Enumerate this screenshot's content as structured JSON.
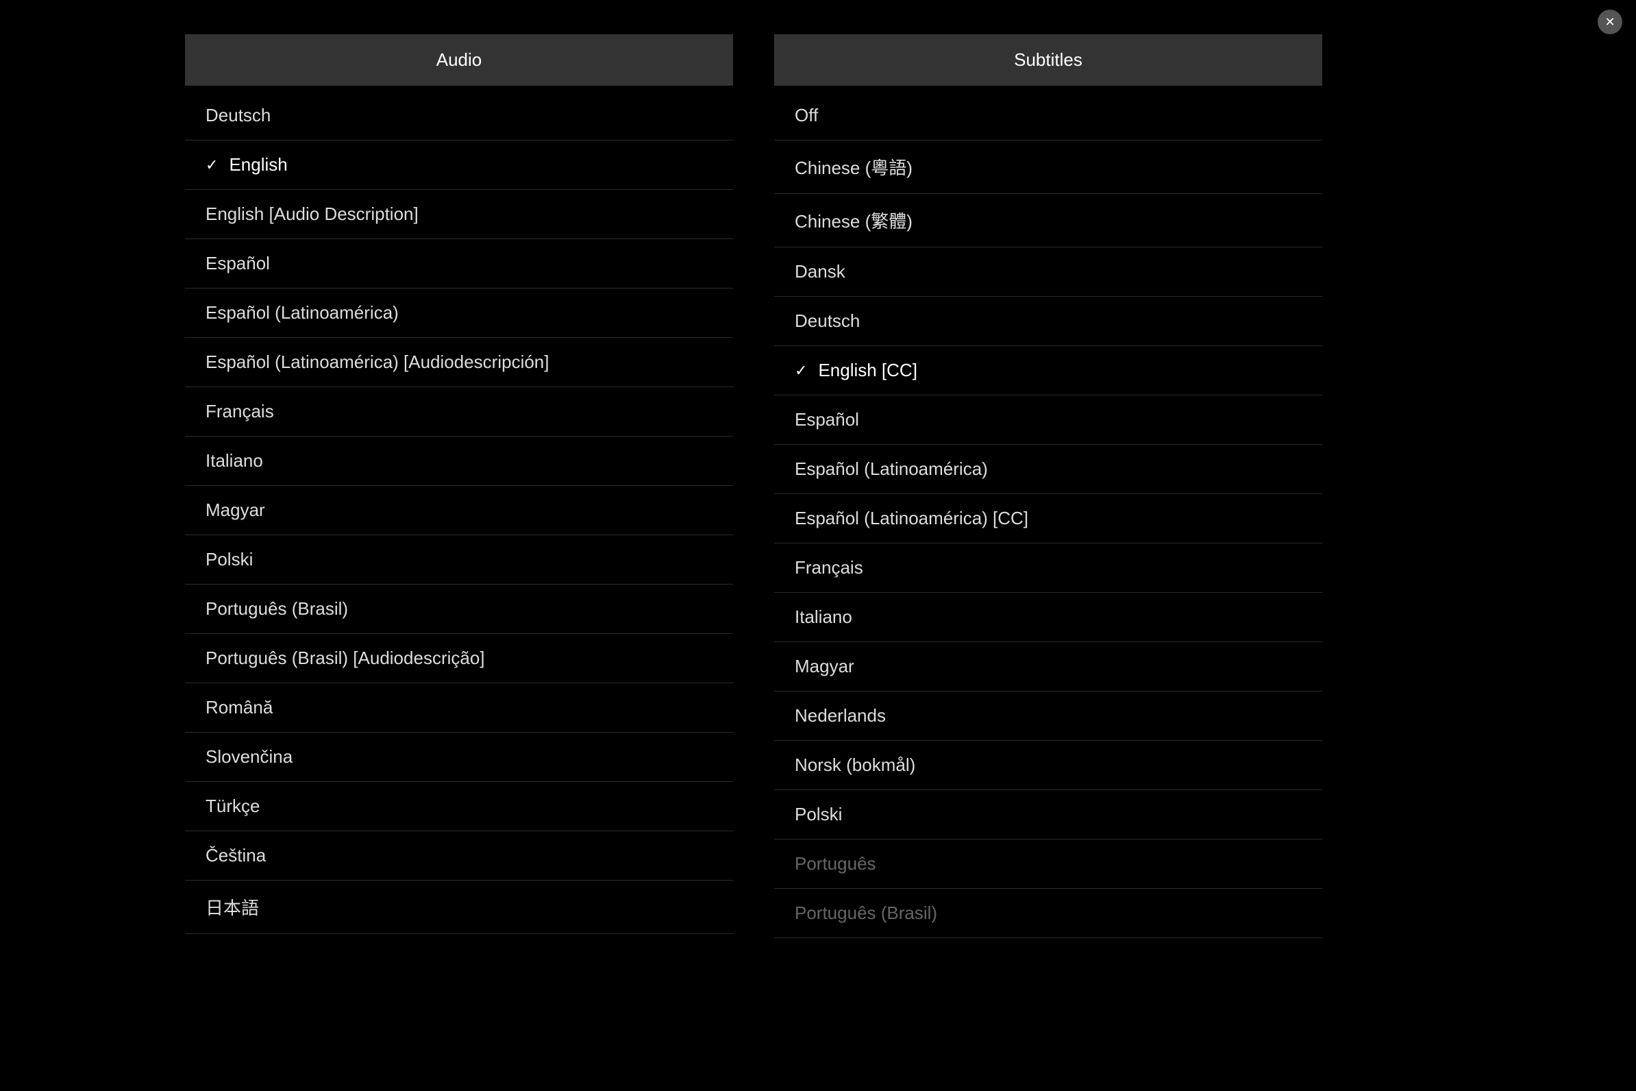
{
  "close_button_label": "×",
  "audio": {
    "header": "Audio",
    "items": [
      {
        "label": "Deutsch",
        "selected": false,
        "dimmed": false
      },
      {
        "label": "English",
        "selected": true,
        "dimmed": false
      },
      {
        "label": "English [Audio Description]",
        "selected": false,
        "dimmed": false
      },
      {
        "label": "Español",
        "selected": false,
        "dimmed": false
      },
      {
        "label": "Español (Latinoamérica)",
        "selected": false,
        "dimmed": false
      },
      {
        "label": "Español (Latinoamérica) [Audiodescripción]",
        "selected": false,
        "dimmed": false
      },
      {
        "label": "Français",
        "selected": false,
        "dimmed": false
      },
      {
        "label": "Italiano",
        "selected": false,
        "dimmed": false
      },
      {
        "label": "Magyar",
        "selected": false,
        "dimmed": false
      },
      {
        "label": "Polski",
        "selected": false,
        "dimmed": false
      },
      {
        "label": "Português (Brasil)",
        "selected": false,
        "dimmed": false
      },
      {
        "label": "Português (Brasil) [Audiodescrição]",
        "selected": false,
        "dimmed": false
      },
      {
        "label": "Română",
        "selected": false,
        "dimmed": false
      },
      {
        "label": "Slovenčina",
        "selected": false,
        "dimmed": false
      },
      {
        "label": "Türkçe",
        "selected": false,
        "dimmed": false
      },
      {
        "label": "Čeština",
        "selected": false,
        "dimmed": false
      },
      {
        "label": "日本語",
        "selected": false,
        "dimmed": false
      }
    ]
  },
  "subtitles": {
    "header": "Subtitles",
    "items": [
      {
        "label": "Off",
        "selected": false,
        "dimmed": false
      },
      {
        "label": "Chinese (粵語)",
        "selected": false,
        "dimmed": false
      },
      {
        "label": "Chinese (繁體)",
        "selected": false,
        "dimmed": false
      },
      {
        "label": "Dansk",
        "selected": false,
        "dimmed": false
      },
      {
        "label": "Deutsch",
        "selected": false,
        "dimmed": false
      },
      {
        "label": "English [CC]",
        "selected": true,
        "dimmed": false
      },
      {
        "label": "Español",
        "selected": false,
        "dimmed": false
      },
      {
        "label": "Español (Latinoamérica)",
        "selected": false,
        "dimmed": false
      },
      {
        "label": "Español (Latinoamérica) [CC]",
        "selected": false,
        "dimmed": false
      },
      {
        "label": "Français",
        "selected": false,
        "dimmed": false
      },
      {
        "label": "Italiano",
        "selected": false,
        "dimmed": false
      },
      {
        "label": "Magyar",
        "selected": false,
        "dimmed": false
      },
      {
        "label": "Nederlands",
        "selected": false,
        "dimmed": false
      },
      {
        "label": "Norsk (bokmål)",
        "selected": false,
        "dimmed": false
      },
      {
        "label": "Polski",
        "selected": false,
        "dimmed": false
      },
      {
        "label": "Português",
        "selected": false,
        "dimmed": true
      },
      {
        "label": "Português (Brasil)",
        "selected": false,
        "dimmed": true
      }
    ]
  }
}
